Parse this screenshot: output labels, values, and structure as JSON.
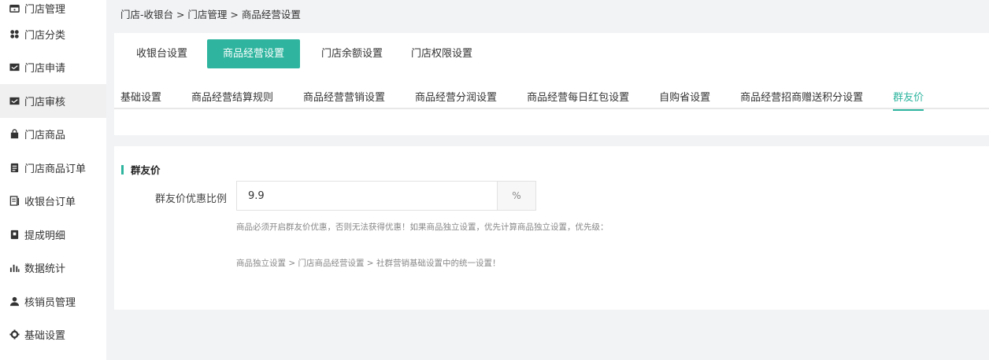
{
  "sidebar": {
    "items": [
      {
        "label": "门店管理",
        "icon": "store-icon"
      },
      {
        "label": "门店分类",
        "icon": "grid-icon"
      },
      {
        "label": "门店申请",
        "icon": "inbox-icon"
      },
      {
        "label": "门店审核",
        "icon": "inbox-check-icon",
        "active": true
      },
      {
        "label": "门店商品",
        "icon": "bag-icon"
      },
      {
        "label": "门店商品订单",
        "icon": "order-icon"
      },
      {
        "label": "收银台订单",
        "icon": "receipt-icon"
      },
      {
        "label": "提成明细",
        "icon": "book-icon"
      },
      {
        "label": "数据统计",
        "icon": "bar-chart-icon"
      },
      {
        "label": "核销员管理",
        "icon": "user-icon"
      },
      {
        "label": "基础设置",
        "icon": "gear-icon"
      }
    ]
  },
  "breadcrumb": "门店-收银台 > 门店管理 > 商品经营设置",
  "primary_tabs": [
    {
      "label": "收银台设置"
    },
    {
      "label": "商品经营设置",
      "active": true
    },
    {
      "label": "门店余额设置"
    },
    {
      "label": "门店权限设置"
    }
  ],
  "secondary_tabs": [
    {
      "label": "基础设置"
    },
    {
      "label": "商品经营结算规则"
    },
    {
      "label": "商品经营营销设置"
    },
    {
      "label": "商品经营分润设置"
    },
    {
      "label": "商品经营每日红包设置"
    },
    {
      "label": "自购省设置"
    },
    {
      "label": "商品经营招商赠送积分设置"
    },
    {
      "label": "群友价",
      "active": true
    }
  ],
  "section": {
    "title": "群友价",
    "field_label": "群友价优惠比例",
    "field_value": "9.9",
    "field_suffix": "%",
    "help_line1": "商品必须开启群友价优惠，否则无法获得优惠！如果商品独立设置，优先计算商品独立设置，优先级：",
    "help_line2": "商品独立设置 > 门店商品经营设置 > 社群营销基础设置中的统一设置！"
  },
  "colors": {
    "accent": "#2fb59f",
    "background": "#f2f3f5"
  }
}
